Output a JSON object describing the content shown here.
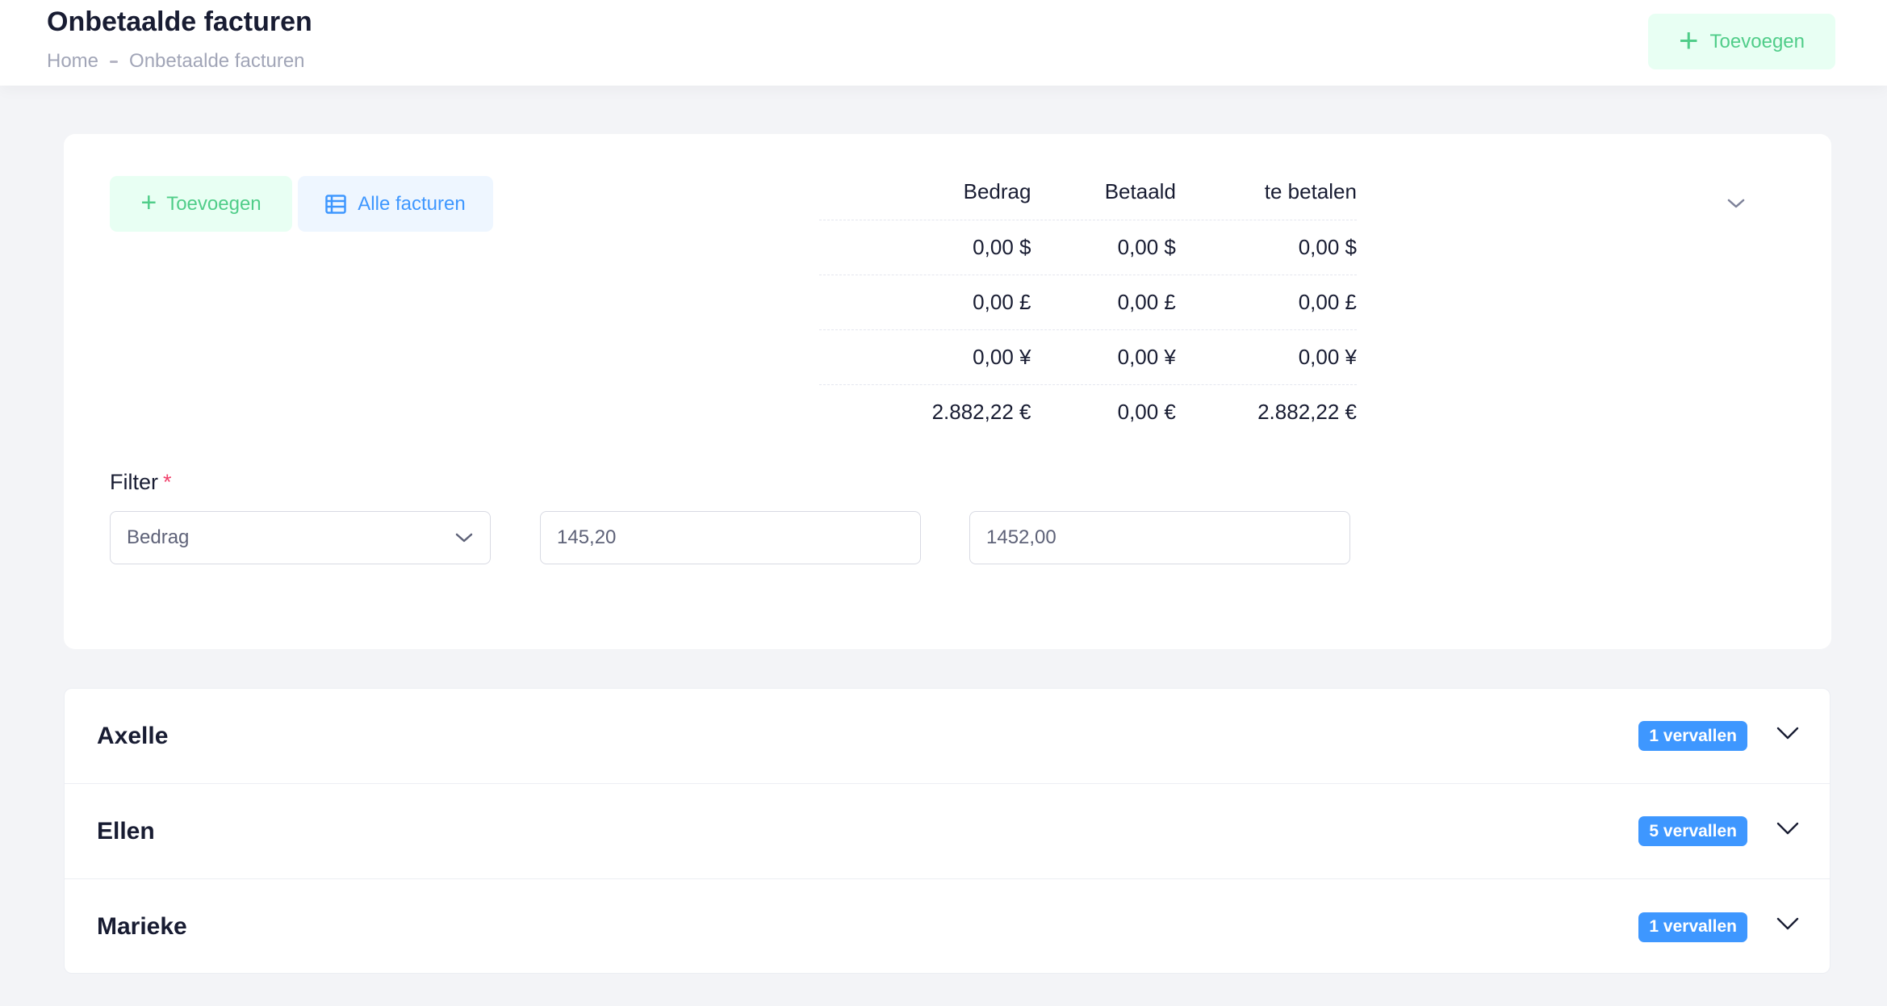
{
  "header": {
    "title": "Onbetaalde facturen",
    "breadcrumb": [
      "Home",
      "Onbetaalde facturen"
    ],
    "add_label": "Toevoegen",
    "add_icon": "plus-icon"
  },
  "summary_card": {
    "add_label": "Toevoegen",
    "all_invoices_label": "Alle facturen",
    "all_invoices_icon": "table-list-icon",
    "collapse_icon": "chevron-down-icon",
    "columns": [
      "Bedrag",
      "Betaald",
      "te betalen"
    ],
    "rows": [
      [
        "0,00 $",
        "0,00 $",
        "0,00 $"
      ],
      [
        "0,00 £",
        "0,00 £",
        "0,00 £"
      ],
      [
        "0,00 ¥",
        "0,00 ¥",
        "0,00 ¥"
      ],
      [
        "2.882,22 €",
        "0,00 €",
        "2.882,22 €"
      ]
    ]
  },
  "filter": {
    "label": "Filter",
    "required_mark": "*",
    "selected": "Bedrag",
    "min_value": "145,20",
    "max_value": "1452,00"
  },
  "groups": [
    {
      "name": "Axelle",
      "badge": "1 vervallen"
    },
    {
      "name": "Ellen",
      "badge": "5 vervallen"
    },
    {
      "name": "Marieke",
      "badge": "1 vervallen"
    }
  ],
  "colors": {
    "success": "#50cd89",
    "success_light": "#e8fff3",
    "primary": "#3e97ff",
    "primary_light": "#eef6ff",
    "danger": "#f1416c"
  }
}
